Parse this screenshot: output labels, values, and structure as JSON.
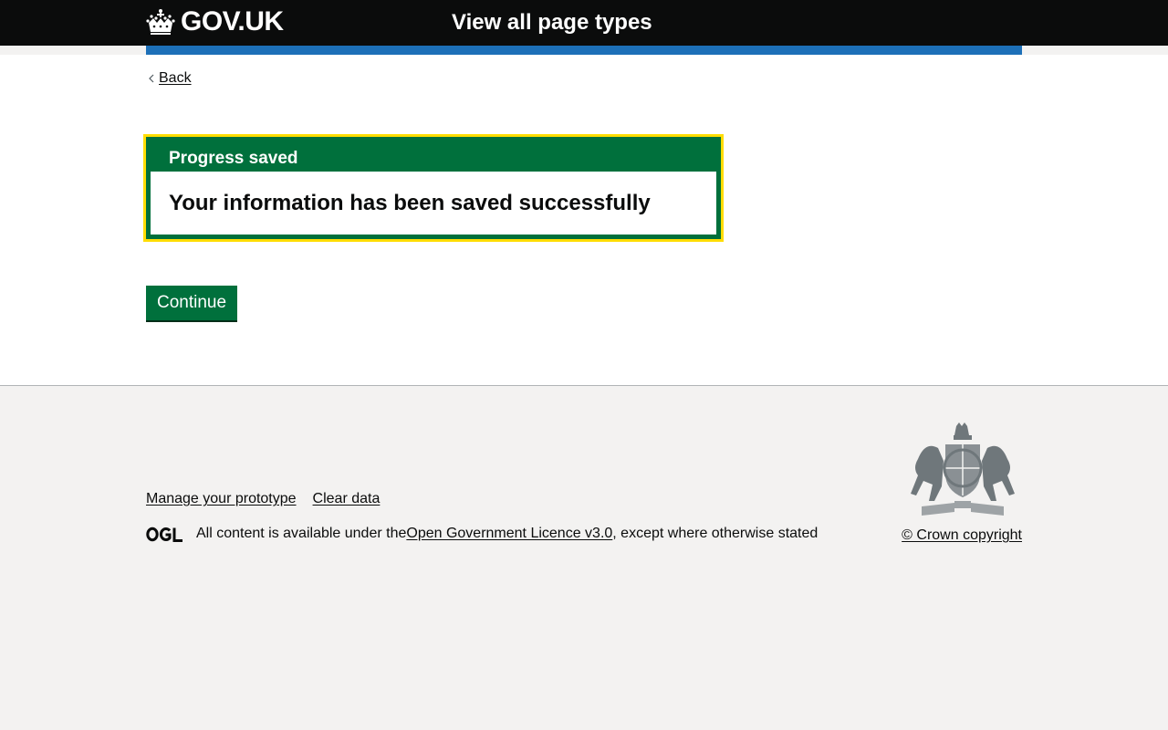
{
  "header": {
    "logo_text": "GOV.UK",
    "service_name": "View all page types"
  },
  "nav": {
    "back_label": "Back"
  },
  "banner": {
    "title": "Progress saved",
    "heading": "Your information has been saved successfully"
  },
  "actions": {
    "continue_label": "Continue"
  },
  "footer": {
    "links": [
      "Manage your prototype",
      "Clear data"
    ],
    "licence_prefix": "All content is available under the ",
    "licence_link": "Open Government Licence v3.0",
    "licence_suffix": ", except where otherwise stated",
    "copyright": "© Crown copyright"
  },
  "colors": {
    "header_bg": "#0b0c0c",
    "accent_blue": "#1d70b8",
    "success_green": "#00703c",
    "focus_yellow": "#ffdd00",
    "footer_bg": "#f3f2f1"
  },
  "icons": {
    "logo": "crown-icon",
    "back": "chevron-left-icon",
    "licence": "ogl-logo",
    "crest": "royal-coat-of-arms"
  }
}
